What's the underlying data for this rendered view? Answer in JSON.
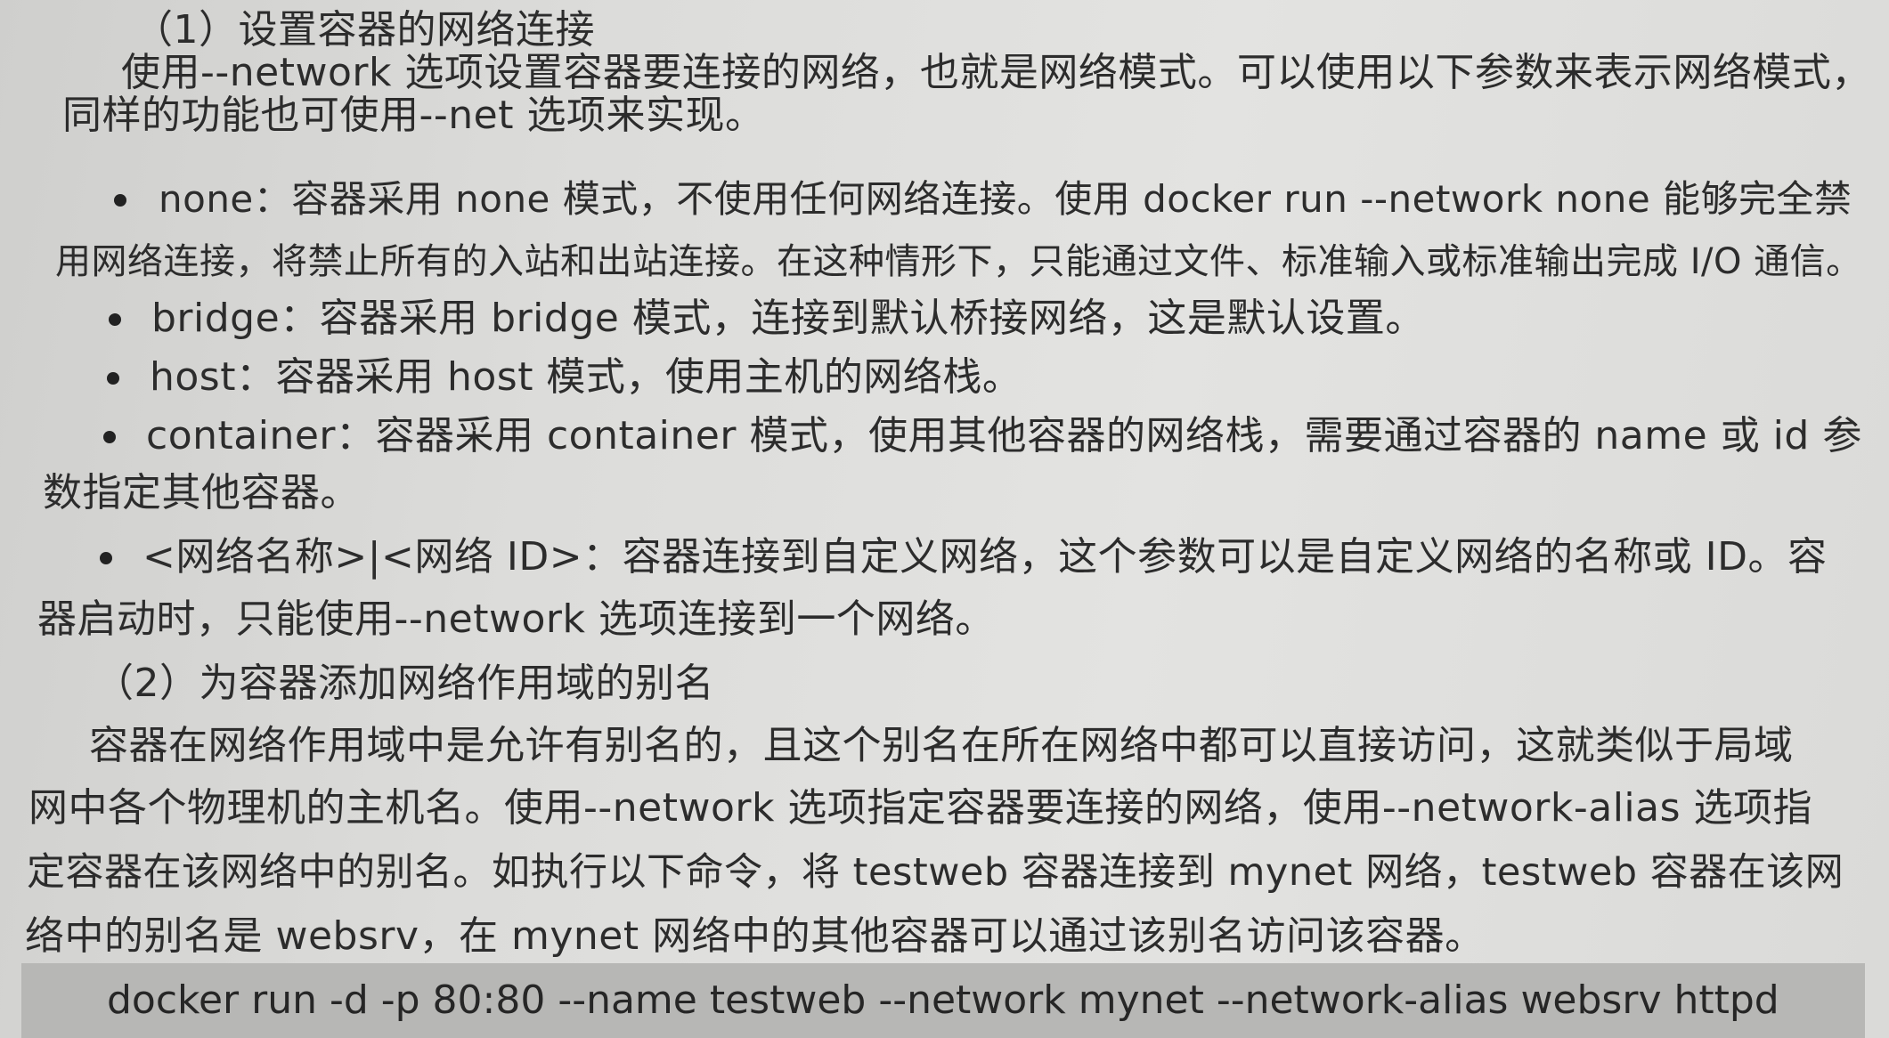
{
  "section1": {
    "heading": "（1）设置容器的网络连接",
    "para_line1": "使用--network 选项设置容器要连接的网络，也就是网络模式。可以使用以下参数来表示网络模式，",
    "para_line2": "同样的功能也可使用--net 选项来实现。",
    "bullets": [
      {
        "line1": "none：容器采用 none 模式，不使用任何网络连接。使用 docker run --network none 能够完全禁",
        "line2": "用网络连接，将禁止所有的入站和出站连接。在这种情形下，只能通过文件、标准输入或标准输出完成 I/O 通信。"
      },
      {
        "line1": "bridge：容器采用 bridge 模式，连接到默认桥接网络，这是默认设置。"
      },
      {
        "line1": "host：容器采用 host 模式，使用主机的网络栈。"
      },
      {
        "line1": "container：容器采用 container 模式，使用其他容器的网络栈，需要通过容器的 name 或 id 参",
        "line2": "数指定其他容器。"
      },
      {
        "line1": "<网络名称>|<网络 ID>：容器连接到自定义网络，这个参数可以是自定义网络的名称或 ID。容",
        "line2": "器启动时，只能使用--network 选项连接到一个网络。"
      }
    ]
  },
  "section2": {
    "heading": "（2）为容器添加网络作用域的别名",
    "para_lines": [
      "容器在网络作用域中是允许有别名的，且这个别名在所在网络中都可以直接访问，这就类似于局域",
      "网中各个物理机的主机名。使用--network 选项指定容器要连接的网络，使用--network-alias 选项指",
      "定容器在该网络中的别名。如执行以下命令，将 testweb 容器连接到 mynet 网络，testweb 容器在该网",
      "络中的别名是 websrv，在 mynet 网络中的其他容器可以通过该别名访问该容器。"
    ]
  },
  "code": "docker run -d -p 80:80 --name testweb --network mynet --network-alias websrv httpd"
}
